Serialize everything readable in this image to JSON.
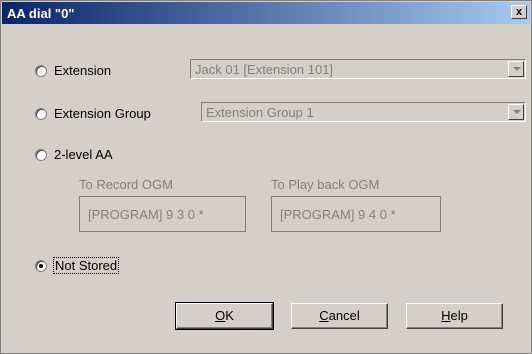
{
  "title": "AA dial \"0\"",
  "close_label": "x",
  "options": {
    "extension": {
      "label": "Extension",
      "value": "Jack 01 [Extension 101]"
    },
    "extension_group": {
      "label": "Extension Group",
      "value": "Extension Group 1"
    },
    "two_level_aa": {
      "label": "2-level AA"
    },
    "not_stored": {
      "label": "Not Stored",
      "selected": true
    }
  },
  "two_level": {
    "record_label": "To Record OGM",
    "record_value": "[PROGRAM] 9 3 0 *",
    "play_label": "To Play back OGM",
    "play_value": "[PROGRAM] 9 4 0 *"
  },
  "buttons": {
    "ok_prefix": "O",
    "ok_rest": "K",
    "cancel_prefix": "C",
    "cancel_rest": "ancel",
    "help_prefix": "H",
    "help_rest": "elp"
  }
}
